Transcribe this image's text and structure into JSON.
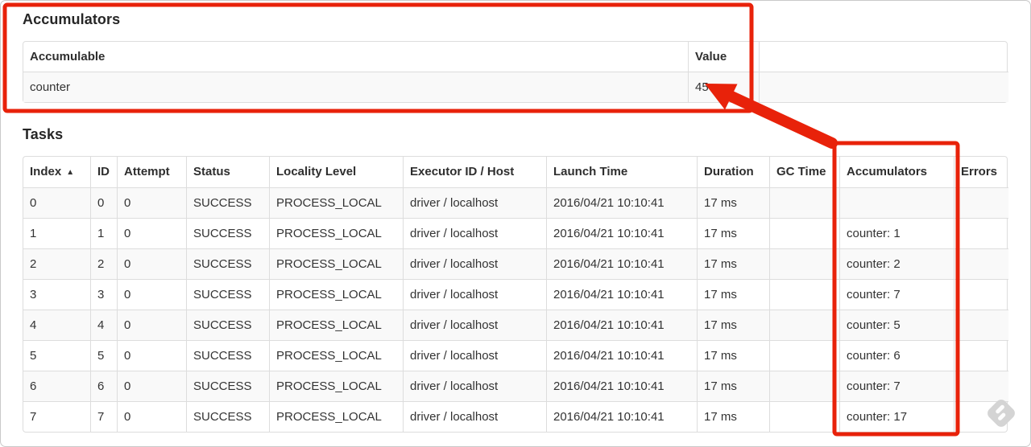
{
  "headings": {
    "accumulators": "Accumulators",
    "tasks": "Tasks"
  },
  "accumulable_table": {
    "headers": {
      "name": "Accumulable",
      "value": "Value",
      "filler": ""
    },
    "fields": [
      "accumulable",
      "value",
      "filler"
    ],
    "rows": [
      {
        "accumulable": "counter",
        "value": "45",
        "filler": ""
      }
    ]
  },
  "tasks_table": {
    "headers": {
      "index": "Index",
      "id": "ID",
      "attempt": "Attempt",
      "status": "Status",
      "locality": "Locality Level",
      "executor": "Executor ID / Host",
      "launch": "Launch Time",
      "duration": "Duration",
      "gc": "GC Time",
      "accumulators": "Accumulators",
      "errors": "Errors"
    },
    "sort_icon": "▲",
    "fields": [
      "index",
      "id",
      "attempt",
      "status",
      "locality",
      "executor",
      "launch",
      "duration",
      "gc",
      "accumulators",
      "errors"
    ],
    "rows": [
      {
        "index": "0",
        "id": "0",
        "attempt": "0",
        "status": "SUCCESS",
        "locality": "PROCESS_LOCAL",
        "executor": "driver / localhost",
        "launch": "2016/04/21 10:10:41",
        "duration": "17 ms",
        "gc": "",
        "accumulators": "",
        "errors": ""
      },
      {
        "index": "1",
        "id": "1",
        "attempt": "0",
        "status": "SUCCESS",
        "locality": "PROCESS_LOCAL",
        "executor": "driver / localhost",
        "launch": "2016/04/21 10:10:41",
        "duration": "17 ms",
        "gc": "",
        "accumulators": "counter: 1",
        "errors": ""
      },
      {
        "index": "2",
        "id": "2",
        "attempt": "0",
        "status": "SUCCESS",
        "locality": "PROCESS_LOCAL",
        "executor": "driver / localhost",
        "launch": "2016/04/21 10:10:41",
        "duration": "17 ms",
        "gc": "",
        "accumulators": "counter: 2",
        "errors": ""
      },
      {
        "index": "3",
        "id": "3",
        "attempt": "0",
        "status": "SUCCESS",
        "locality": "PROCESS_LOCAL",
        "executor": "driver / localhost",
        "launch": "2016/04/21 10:10:41",
        "duration": "17 ms",
        "gc": "",
        "accumulators": "counter: 7",
        "errors": ""
      },
      {
        "index": "4",
        "id": "4",
        "attempt": "0",
        "status": "SUCCESS",
        "locality": "PROCESS_LOCAL",
        "executor": "driver / localhost",
        "launch": "2016/04/21 10:10:41",
        "duration": "17 ms",
        "gc": "",
        "accumulators": "counter: 5",
        "errors": ""
      },
      {
        "index": "5",
        "id": "5",
        "attempt": "0",
        "status": "SUCCESS",
        "locality": "PROCESS_LOCAL",
        "executor": "driver / localhost",
        "launch": "2016/04/21 10:10:41",
        "duration": "17 ms",
        "gc": "",
        "accumulators": "counter: 6",
        "errors": ""
      },
      {
        "index": "6",
        "id": "6",
        "attempt": "0",
        "status": "SUCCESS",
        "locality": "PROCESS_LOCAL",
        "executor": "driver / localhost",
        "launch": "2016/04/21 10:10:41",
        "duration": "17 ms",
        "gc": "",
        "accumulators": "counter: 7",
        "errors": ""
      },
      {
        "index": "7",
        "id": "7",
        "attempt": "0",
        "status": "SUCCESS",
        "locality": "PROCESS_LOCAL",
        "executor": "driver / localhost",
        "launch": "2016/04/21 10:10:41",
        "duration": "17 ms",
        "gc": "",
        "accumulators": "counter: 17",
        "errors": ""
      }
    ]
  },
  "annotations": {
    "color": "#e8220a",
    "highlight_value": "45",
    "highlighted_column": "Accumulators"
  }
}
